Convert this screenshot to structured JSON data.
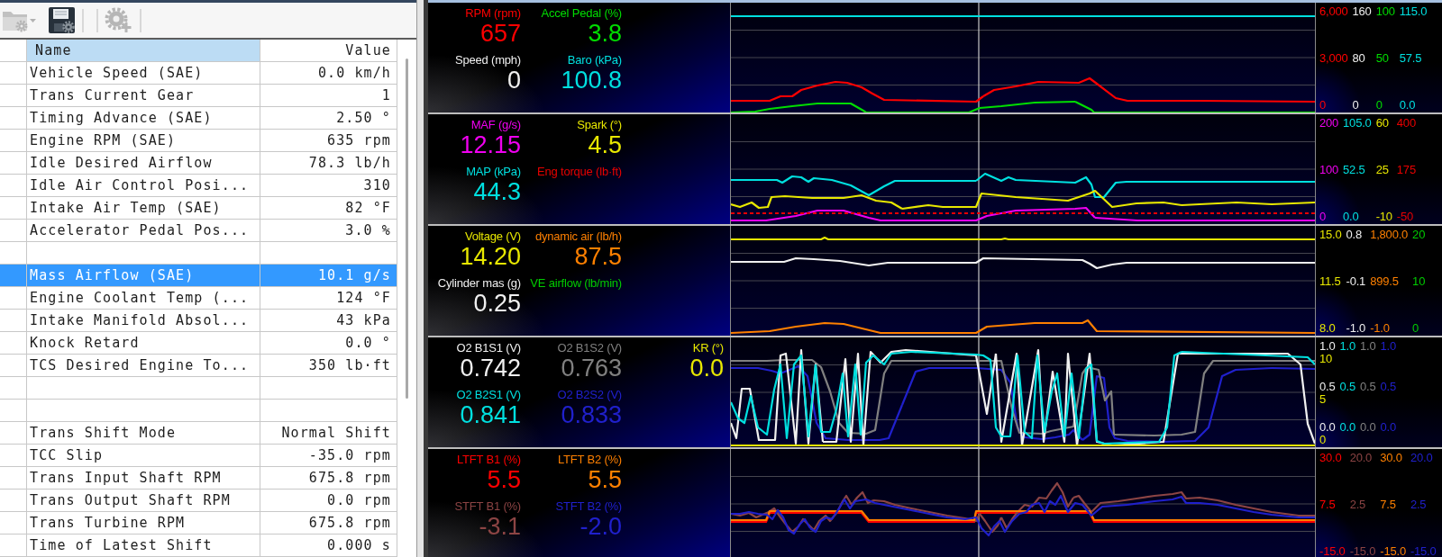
{
  "toolbar": [
    {
      "disabled": true,
      "dropdown": true
    },
    {
      "disabled": false,
      "dropdown": false
    },
    {
      "disabled": true,
      "dropdown": false
    }
  ],
  "table": {
    "columns": [
      {
        "label": "Name",
        "selected": true
      },
      {
        "label": "Value",
        "selected": false
      }
    ],
    "rows": [
      {
        "kind": "param",
        "name": "Vehicle Speed (SAE)",
        "value": "0.0 km/h",
        "selected": false
      },
      {
        "kind": "param",
        "name": "Trans Current Gear",
        "value": "1",
        "selected": false
      },
      {
        "kind": "param",
        "name": "Timing Advance (SAE)",
        "value": "2.50 °",
        "selected": false
      },
      {
        "kind": "param",
        "name": "Engine RPM (SAE)",
        "value": "635 rpm",
        "selected": false
      },
      {
        "kind": "param",
        "name": "Idle Desired Airflow",
        "value": "78.3 lb/h",
        "selected": false
      },
      {
        "kind": "param",
        "name": "Idle Air Control Posi...",
        "value": "310",
        "selected": false
      },
      {
        "kind": "param",
        "name": "Intake Air Temp (SAE)",
        "value": "82 °F",
        "selected": false
      },
      {
        "kind": "param",
        "name": "Accelerator Pedal Pos...",
        "value": "3.0 %",
        "selected": false
      },
      {
        "kind": "blank",
        "selected": false
      },
      {
        "kind": "param",
        "name": "Mass Airflow (SAE)",
        "value": "10.1 g/s",
        "selected": true
      },
      {
        "kind": "param",
        "name": "Engine Coolant Temp (...",
        "value": "124 °F",
        "selected": false
      },
      {
        "kind": "param",
        "name": "Intake Manifold Absol...",
        "value": "43 kPa",
        "selected": false
      },
      {
        "kind": "param",
        "name": "Knock Retard",
        "value": "0.0 °",
        "selected": false
      },
      {
        "kind": "param",
        "name": "TCS Desired Engine To...",
        "value": "350 lb·ft",
        "selected": false
      },
      {
        "kind": "blank",
        "selected": false
      },
      {
        "kind": "blank",
        "selected": false
      },
      {
        "kind": "param",
        "name": "Trans Shift Mode",
        "value": "Normal Shift",
        "selected": false
      },
      {
        "kind": "param",
        "name": "TCC Slip",
        "value": "-35.0 rpm",
        "selected": false
      },
      {
        "kind": "param",
        "name": "Trans Input Shaft RPM",
        "value": "675.8 rpm",
        "selected": false
      },
      {
        "kind": "param",
        "name": "Trans Output Shaft RPM",
        "value": "0.0 rpm",
        "selected": false
      },
      {
        "kind": "param",
        "name": "Trans Turbine RPM",
        "value": "675.8 rpm",
        "selected": false
      },
      {
        "kind": "param",
        "name": "Time of Latest Shift",
        "value": "0.000 s",
        "selected": false
      }
    ]
  },
  "panels": [
    {
      "columns": [
        [
          {
            "label": "RPM (rpm)",
            "value": "657",
            "color": "#ff0000",
            "scale": [
              "6,000",
              "3,000",
              "0"
            ]
          },
          {
            "label": "Speed (mph)",
            "value": "0",
            "color": "#f0f0f0",
            "scale": [
              "160",
              "80",
              "0"
            ]
          }
        ],
        [
          {
            "label": "Accel Pedal (%)",
            "value": "3.8",
            "color": "#00dd00",
            "scale": [
              "100",
              "50",
              "0"
            ]
          },
          {
            "label": "Baro (kPa)",
            "value": "100.8",
            "color": "#00e0e0",
            "scale": [
              "115.0",
              "57.5",
              "0.0"
            ]
          }
        ]
      ]
    },
    {
      "columns": [
        [
          {
            "label": "MAF (g/s)",
            "value": "12.15",
            "color": "#f000f0",
            "scale": [
              "200",
              "100",
              "0"
            ]
          },
          {
            "label": "MAP (kPa)",
            "value": "44.3",
            "color": "#00e0e0",
            "scale": [
              "105.0",
              "52.5",
              "0.0"
            ]
          }
        ],
        [
          {
            "label": "Spark (°)",
            "value": "4.5",
            "color": "#e8e800",
            "scale": [
              "60",
              "25",
              "-10"
            ]
          },
          {
            "label": "Eng torque (lb·ft)",
            "color": "#e80000",
            "scale": [
              "400",
              "175",
              "-50"
            ]
          }
        ]
      ]
    },
    {
      "columns": [
        [
          {
            "label": "Voltage (V)",
            "value": "14.20",
            "color": "#e8e800",
            "scale": [
              "15.0",
              "11.5",
              "8.0"
            ]
          },
          {
            "label": "Cylinder mas (g)",
            "value": "0.25",
            "color": "#f0f0f0",
            "scale": [
              "0.8",
              "-0.1",
              "-1.0"
            ]
          }
        ],
        [
          {
            "label": "dynamic air (lb/h)",
            "value": "87.5",
            "color": "#ff8000",
            "scale": [
              "1,800.0",
              "899.5",
              "-1.0"
            ]
          },
          {
            "label": "VE airflow (lb/min)",
            "color": "#00cc00",
            "scale": [
              "20",
              "10",
              "0"
            ]
          }
        ]
      ]
    },
    {
      "columns": [
        [
          {
            "label": "O2 B1S1 (V)",
            "value": "0.742",
            "color": "#f0f0f0",
            "scale": [
              "1.0",
              "0.5",
              "0.0"
            ]
          },
          {
            "label": "O2 B2S1 (V)",
            "value": "0.841",
            "color": "#00e0e0",
            "scale": [
              "1.0",
              "0.5",
              "0.0"
            ]
          }
        ],
        [
          {
            "label": "O2 B1S2 (V)",
            "value": "0.763",
            "color": "#808080",
            "scale": [
              "1.0",
              "0.5",
              "0.0"
            ]
          },
          {
            "label": "O2 B2S2 (V)",
            "value": "0.833",
            "color": "#2020cc",
            "scale": [
              "1.0",
              "0.5",
              "0.0"
            ]
          }
        ],
        [
          {
            "label": "KR (°)",
            "value": "0.0",
            "color": "#e8e800",
            "scale": [
              "10",
              "5",
              "0"
            ]
          }
        ]
      ]
    },
    {
      "columns": [
        [
          {
            "label": "LTFT B1 (%)",
            "value": "5.5",
            "color": "#ff0000",
            "scale": [
              "30.0",
              "7.5",
              "-15.0"
            ]
          },
          {
            "label": "STFT B1 (%)",
            "value": "-3.1",
            "color": "#8c4444",
            "scale": [
              "20.0",
              "2.5",
              "-15.0"
            ]
          }
        ],
        [
          {
            "label": "LTFT B2 (%)",
            "value": "5.5",
            "color": "#ff8000",
            "scale": [
              "30.0",
              "7.5",
              "-15.0"
            ]
          },
          {
            "label": "STFT B2 (%)",
            "value": "-2.0",
            "color": "#2020cc",
            "scale": [
              "20.0",
              "2.5",
              "-15.0"
            ]
          }
        ]
      ]
    }
  ]
}
